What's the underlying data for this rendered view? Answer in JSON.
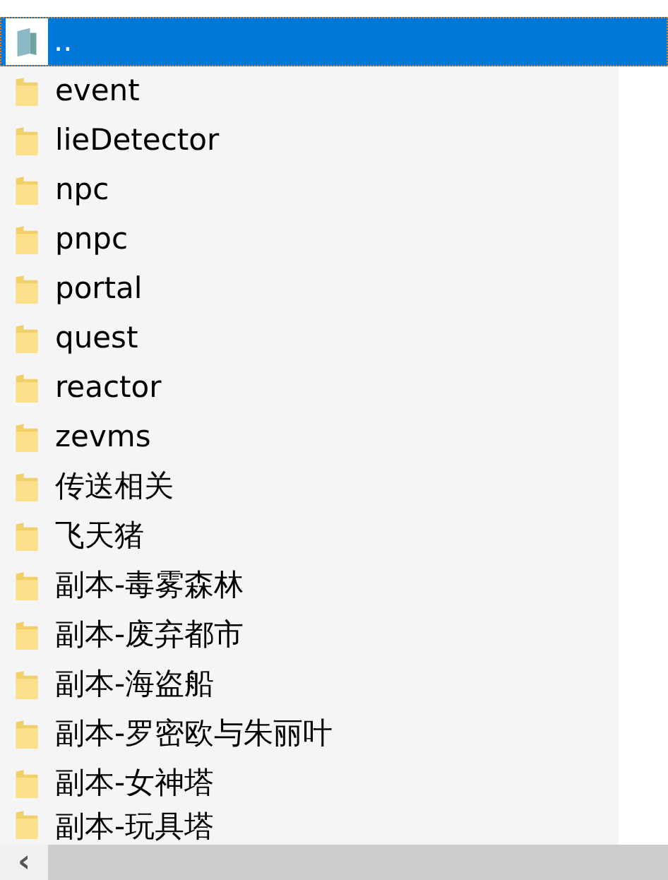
{
  "items": [
    {
      "name": "..",
      "kind": "parent",
      "selected": true
    },
    {
      "name": "event",
      "kind": "folder",
      "selected": false
    },
    {
      "name": "lieDetector",
      "kind": "folder",
      "selected": false
    },
    {
      "name": "npc",
      "kind": "folder",
      "selected": false
    },
    {
      "name": "pnpc",
      "kind": "folder",
      "selected": false
    },
    {
      "name": "portal",
      "kind": "folder",
      "selected": false
    },
    {
      "name": "quest",
      "kind": "folder",
      "selected": false
    },
    {
      "name": "reactor",
      "kind": "folder",
      "selected": false
    },
    {
      "name": "zevms",
      "kind": "folder",
      "selected": false
    },
    {
      "name": "传送相关",
      "kind": "folder",
      "selected": false
    },
    {
      "name": "飞天猪",
      "kind": "folder",
      "selected": false
    },
    {
      "name": "副本-毒雾森林",
      "kind": "folder",
      "selected": false
    },
    {
      "name": "副本-废弃都市",
      "kind": "folder",
      "selected": false
    },
    {
      "name": "副本-海盗船",
      "kind": "folder",
      "selected": false
    },
    {
      "name": "副本-罗密欧与朱丽叶",
      "kind": "folder",
      "selected": false
    },
    {
      "name": "副本-女神塔",
      "kind": "folder",
      "selected": false
    },
    {
      "name": "副本-玩具塔",
      "kind": "folder",
      "selected": false
    }
  ],
  "scrollbar": {
    "arrow": "‹"
  }
}
